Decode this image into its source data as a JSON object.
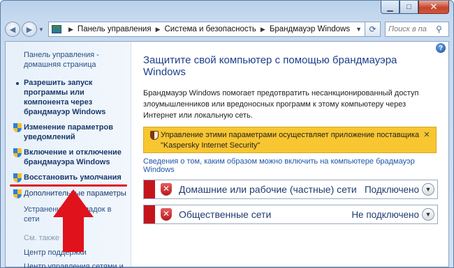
{
  "window": {
    "caption_buttons": {
      "minimize": "▁",
      "maximize": "□",
      "close": "✕"
    }
  },
  "address_bar": {
    "crumbs": [
      "Панель управления",
      "Система и безопасность",
      "Брандмауэр Windows"
    ],
    "search_placeholder": "Поиск в па"
  },
  "sidebar": {
    "home_label": "Панель управления - домашняя страница",
    "items": [
      {
        "label": "Разрешить запуск программы или компонента через брандмауэр Windows",
        "icon": "bullet"
      },
      {
        "label": "Изменение параметров уведомлений",
        "icon": "shield-icon"
      },
      {
        "label": "Включение и отключение брандмауэра Windows",
        "icon": "shield-icon"
      },
      {
        "label": "Восстановить умолчания",
        "icon": "shield-icon"
      },
      {
        "label": "Дополнительные параметры",
        "icon": "shield-icon"
      }
    ],
    "network_troubleshoot": "Устранение неполадок в сети",
    "see_also": "См. также",
    "see_also_links": [
      "Центр поддержки",
      "Центр управления сетями и общим доступом"
    ]
  },
  "main": {
    "help": "?",
    "title": "Защитите свой компьютер с помощью брандмауэра Windows",
    "description": "Брандмауэр Windows помогает предотвратить несанкционированный доступ злоумышленников или вредоносных программ к этому компьютеру через Интернет или локальную сеть.",
    "warning": "Управление этими параметрами осуществляет приложение поставщика \"Kaspersky Internet Security\"",
    "info_link": "Сведения о том, каким образом можно включить на компьютере брадмауэр Windows",
    "networks": [
      {
        "name": "Домашние или рабочие (частные) сети",
        "status": "Подключено"
      },
      {
        "name": "Общественные сети",
        "status": "Не подключено"
      }
    ]
  },
  "colors": {
    "accent": "#1c3f8a",
    "warning_bg": "#f8c630",
    "network_bar": "#c4151c",
    "annotation_red": "#e0121c"
  }
}
